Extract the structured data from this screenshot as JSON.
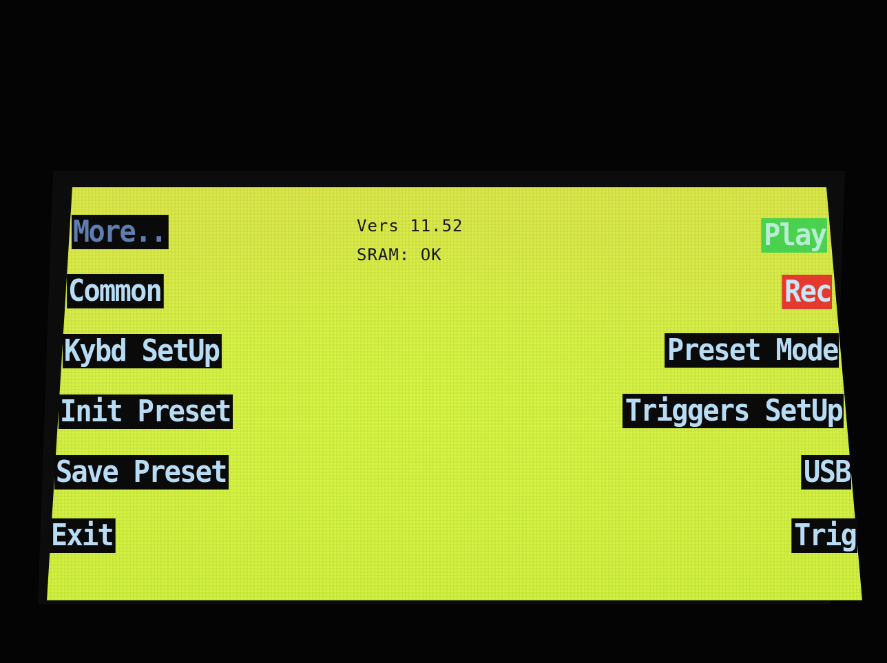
{
  "status": {
    "version": "Vers 11.52",
    "sram": "SRAM: OK"
  },
  "left_menu": [
    {
      "label": "More.."
    },
    {
      "label": "Common"
    },
    {
      "label": "Kybd SetUp"
    },
    {
      "label": "Init Preset"
    },
    {
      "label": "Save Preset"
    },
    {
      "label": "Exit"
    }
  ],
  "right_menu": [
    {
      "label": "Play"
    },
    {
      "label": "Rec"
    },
    {
      "label": "Preset Mode"
    },
    {
      "label": "Triggers SetUp"
    },
    {
      "label": "USB"
    },
    {
      "label": "Trig"
    }
  ],
  "colors": {
    "screen": "#d6ef47",
    "button_bg": "#0a0a0a",
    "button_text": "#b8dcf4",
    "more_text": "#5f7db0",
    "play_bg": "#4ad24e",
    "rec_bg": "#e5392f",
    "status_text": "#151515"
  }
}
